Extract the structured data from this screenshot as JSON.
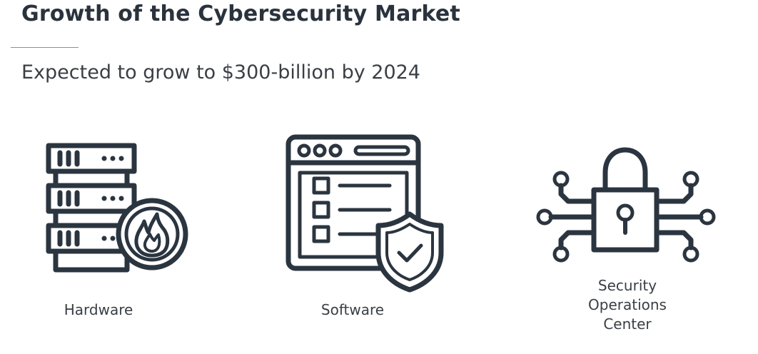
{
  "slide": {
    "title": "Growth of the Cybersecurity Market",
    "subtitle": "Expected to grow to $300-billion by 2024"
  },
  "items": [
    {
      "icon": "server-firewall-icon",
      "label": "Hardware"
    },
    {
      "icon": "browser-shield-icon",
      "label": "Software"
    },
    {
      "icon": "circuit-lock-icon",
      "label_lines": [
        "Security",
        "Operations",
        "Center"
      ]
    }
  ],
  "colors": {
    "text": "#2a333d",
    "icon_stroke": "#2b3540",
    "rule": "#8a8f94",
    "background": "#ffffff"
  }
}
